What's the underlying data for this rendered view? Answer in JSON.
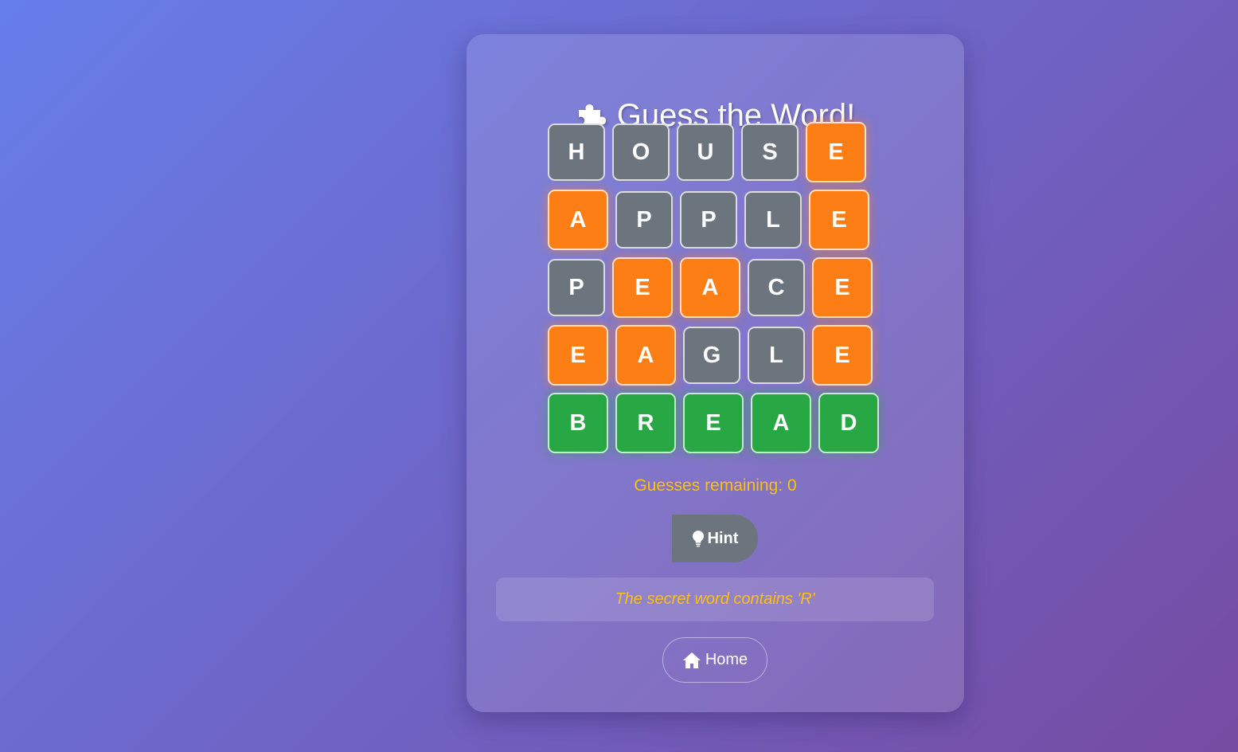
{
  "header": {
    "icon": "puzzle-piece-icon",
    "title": "Guess the Word!"
  },
  "colors": {
    "absent": "#6c757d",
    "present": "#fd7e14",
    "correct": "#28a745",
    "accent_text": "#ffc107"
  },
  "board": {
    "rows": [
      {
        "tiles": [
          {
            "letter": "H",
            "state": "absent"
          },
          {
            "letter": "O",
            "state": "absent"
          },
          {
            "letter": "U",
            "state": "absent"
          },
          {
            "letter": "S",
            "state": "absent"
          },
          {
            "letter": "E",
            "state": "present"
          }
        ]
      },
      {
        "tiles": [
          {
            "letter": "A",
            "state": "present"
          },
          {
            "letter": "P",
            "state": "absent"
          },
          {
            "letter": "P",
            "state": "absent"
          },
          {
            "letter": "L",
            "state": "absent"
          },
          {
            "letter": "E",
            "state": "present"
          }
        ]
      },
      {
        "tiles": [
          {
            "letter": "P",
            "state": "absent"
          },
          {
            "letter": "E",
            "state": "present"
          },
          {
            "letter": "A",
            "state": "present"
          },
          {
            "letter": "C",
            "state": "absent"
          },
          {
            "letter": "E",
            "state": "present"
          }
        ]
      },
      {
        "tiles": [
          {
            "letter": "E",
            "state": "present"
          },
          {
            "letter": "A",
            "state": "present"
          },
          {
            "letter": "G",
            "state": "absent"
          },
          {
            "letter": "L",
            "state": "absent"
          },
          {
            "letter": "E",
            "state": "present"
          }
        ]
      },
      {
        "tiles": [
          {
            "letter": "B",
            "state": "correct"
          },
          {
            "letter": "R",
            "state": "correct"
          },
          {
            "letter": "E",
            "state": "correct"
          },
          {
            "letter": "A",
            "state": "correct"
          },
          {
            "letter": "D",
            "state": "correct"
          }
        ]
      }
    ]
  },
  "status": {
    "remaining_text": "Guesses remaining: 0"
  },
  "hint": {
    "button_label": "Hint",
    "button_icon": "lightbulb-icon",
    "message": "The secret word contains 'R'"
  },
  "nav": {
    "home_label": "Home",
    "home_icon": "home-icon"
  }
}
